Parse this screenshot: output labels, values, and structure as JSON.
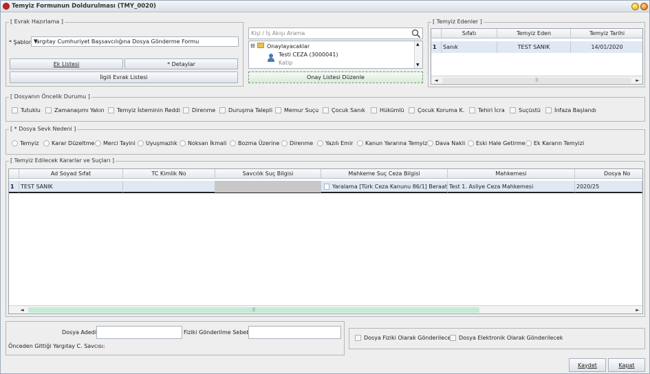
{
  "window": {
    "title": "Temyiz Formunun Doldurulması (TMY_0020)"
  },
  "evrak": {
    "legend": "[ Evrak Hazırlama ]",
    "sablon_label": "* Şablon",
    "sablon_value": "Yargıtay Cumhuriyet Başsavcılığına Dosya Gönderme Formu",
    "ek_listesi": "Ek Listesi",
    "detaylar": "* Detaylar",
    "ilgili_evrak": "İlgili Evrak Listesi"
  },
  "kisi": {
    "search_placeholder": "Kişi / İş Akışı Arama",
    "tree_root": "Onaylayacaklar",
    "tree_person": "Testi CEZA (3000041)",
    "tree_role": "Katip",
    "onay_button": "Onay Listesi Düzenle"
  },
  "edenler": {
    "legend": "[ Temyiz Edenler ]",
    "columns": [
      "Sıfatı",
      "Temyiz Eden",
      "Temyiz Tarihi"
    ],
    "rows": [
      {
        "no": "1",
        "sifat": "Sanık",
        "eden": "TEST SANIK",
        "tarih": "14/01/2020"
      }
    ]
  },
  "oncelik": {
    "legend": "[ Dosyanın Öncelik Durumu ]",
    "items": [
      "Tutuklu",
      "Zamanaşımı Yakın",
      "Temyiz İsteminin Reddi",
      "Direnme",
      "Duruşma Talepli",
      "Memur Suçu",
      "Çocuk Sanık",
      "Hükümlü",
      "Çocuk Koruma K.",
      "Tehiri İcra",
      "Suçüstü",
      "İnfaza Başlandı"
    ]
  },
  "sevk": {
    "legend": "[ * Dosya Sevk Nedeni ]",
    "items": [
      "Temyiz",
      "Karar Düzeltme",
      "Merci Tayini",
      "Uyuşmazlık",
      "Noksan İkmali",
      "Bozma Üzerine",
      "Direnme",
      "Yazılı Emir",
      "Kanun Yararına Temyiz",
      "Dava Nakli",
      "Eski Hale Getirme",
      "Ek Kararın Temyizi"
    ]
  },
  "kararlar": {
    "legend": "[ Temyiz Edilecek Kararlar ve Suçları ]",
    "columns": [
      "Ad Soyad Sıfat",
      "TC Kimlik No",
      "Savcılık Suç Bilgisi",
      "Mahkeme Suç Ceza Bilgisi",
      "Mahkemesi",
      "Dosya No"
    ],
    "rows": [
      {
        "no": "1",
        "ad": "TEST SANIK",
        "tc": "",
        "savcilik": "",
        "mahkeme_suc": "Yaralama [Türk Ceza Kanunu 86/1] Beraat",
        "mahkemesi": "Test 1. Asliye Ceza Mahkemesi",
        "dosya": "2020/25"
      }
    ]
  },
  "bottom": {
    "dosya_adedi": "Dosya Adedi:",
    "fiziki_sebep": "Fiziki Gönderilme Sebebi:",
    "onceden": "Önceden Gittiği Yargıtay C. Savcısı:",
    "fiziki_cb": "Dosya Fiziki Olarak Gönderilecek",
    "elektronik_cb": "Dosya Elektronik Olarak Gönderilecek",
    "kaydet": "Kaydet",
    "kapat": "Kapat"
  },
  "colors": {
    "accent_row": "#dfe8f3",
    "scroll_thumb": "#c5ead6",
    "tb_yellow": "#f2c12e",
    "tb_orange": "#ee8f2a"
  }
}
